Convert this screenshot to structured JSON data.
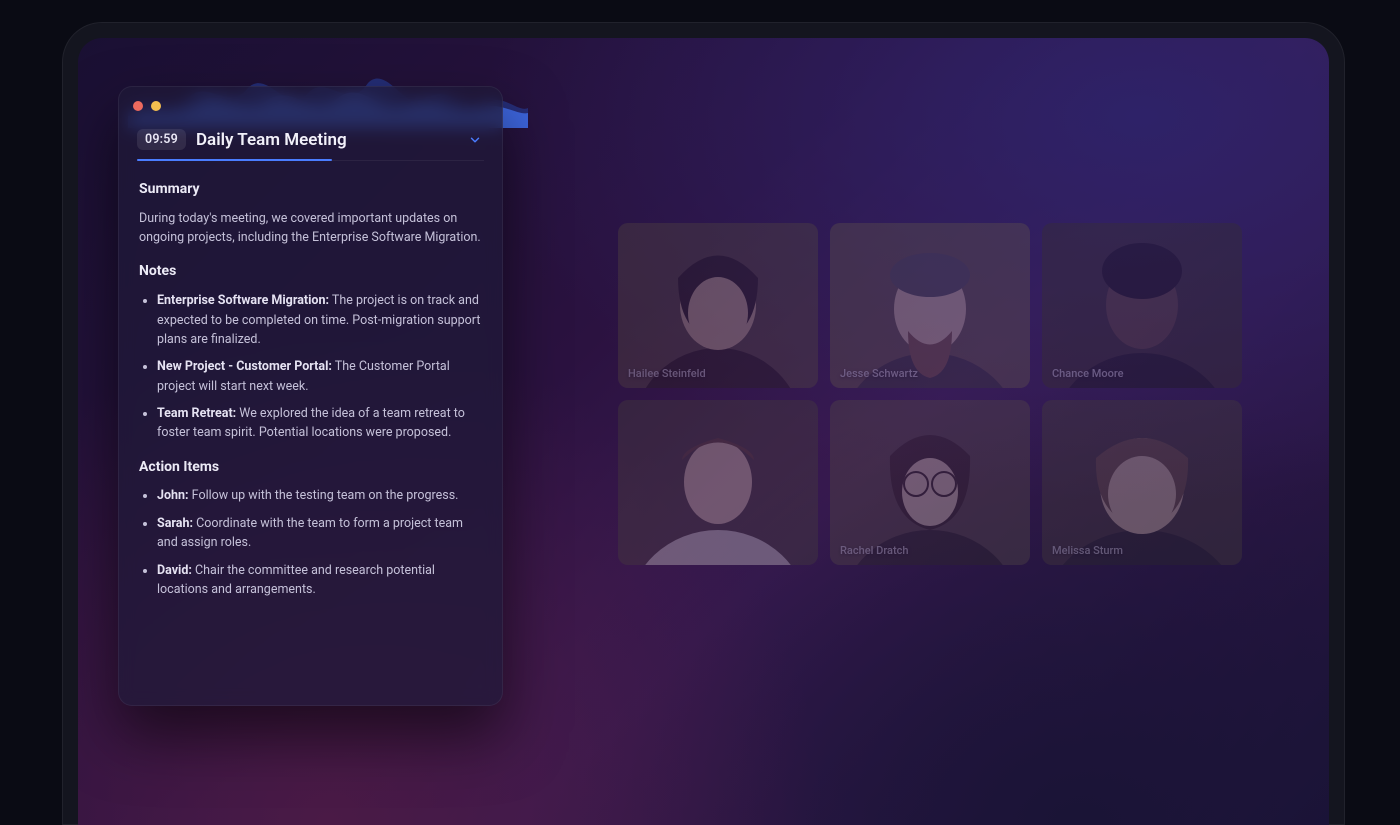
{
  "meeting": {
    "time": "09:59",
    "title": "Daily Team Meeting"
  },
  "sections": {
    "summary_heading": "Summary",
    "summary_text": "During today's meeting, we covered important updates on ongoing projects, including the Enterprise Software Migration.",
    "notes_heading": "Notes",
    "notes": [
      {
        "label": "Enterprise Software Migration:",
        "text": " The project is on track and expected to be completed on time. Post-migration support plans are finalized."
      },
      {
        "label": "New Project - Customer Portal:",
        "text": " The Customer Portal project will start next week."
      },
      {
        "label": "Team Retreat:",
        "text": " We explored the idea of a team retreat to foster team spirit. Potential locations were proposed."
      }
    ],
    "action_items_heading": "Action Items",
    "action_items": [
      {
        "person": "John:",
        "text": " Follow up with the testing team on the progress."
      },
      {
        "person": "Sarah:",
        "text": " Coordinate with the team to form a project team and assign roles."
      },
      {
        "person": "David:",
        "text": " Chair the committee and research potential locations and arrangements."
      }
    ]
  },
  "participants": [
    {
      "name": "Hailee Steinfeld",
      "skin": "#d9b38c",
      "hair": "#2b1f1a",
      "bg": "#5a4a3a"
    },
    {
      "name": "Jesse Schwartz",
      "skin": "#e6c2a0",
      "hair": "#8a5a3a",
      "bg": "#6a5842"
    },
    {
      "name": "Chance Moore",
      "skin": "#6b4a33",
      "hair": "#1a1410",
      "bg": "#3a3228"
    },
    {
      "name": "",
      "skin": "#e8c9a8",
      "hair": "#6a4a2e",
      "bg": "#4a4238"
    },
    {
      "name": "Rachel Dratch",
      "skin": "#ecd0b2",
      "hair": "#3a2a1e",
      "bg": "#5a4e40"
    },
    {
      "name": "Melissa Sturm",
      "skin": "#e8c6a2",
      "hair": "#7a5a3a",
      "bg": "#4a4036"
    }
  ],
  "colors": {
    "accent": "#4a7dff"
  }
}
